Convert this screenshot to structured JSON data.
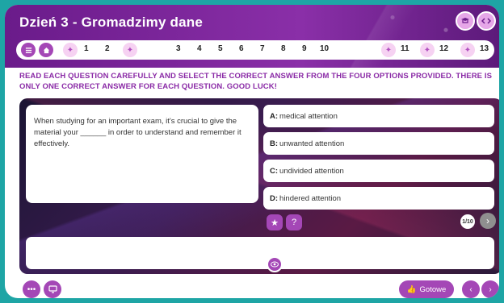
{
  "header": {
    "title": "Dzień 3 - Gromadzimy dane",
    "icons": {
      "left": "cap-icon",
      "right": "code-icon"
    }
  },
  "nav": {
    "menu_icon": "menu-icon",
    "home_icon": "home-icon",
    "numbers": [
      "1",
      "2",
      "3",
      "4",
      "5",
      "6",
      "7",
      "8",
      "9",
      "10",
      "11",
      "12",
      "13"
    ]
  },
  "instruction": "READ EACH QUESTION CAREFULLY AND SELECT THE CORRECT ANSWER FROM THE FOUR OPTIONS PROVIDED. THERE IS ONLY ONE CORRECT ANSWER FOR EACH QUESTION. GOOD LUCK!",
  "question": {
    "text": "When studying for an important exam, it's crucial to give the material your ______ in order to understand and remember it effectively."
  },
  "options": [
    {
      "key": "A:",
      "text": "medical attention"
    },
    {
      "key": "B:",
      "text": "unwanted attention"
    },
    {
      "key": "C:",
      "text": "undivided attention"
    },
    {
      "key": "D:",
      "text": "hindered attention"
    }
  ],
  "counter": "1/10",
  "footer": {
    "done_label": "Gotowe"
  },
  "colors": {
    "accent": "#a447b6",
    "header": "#6a1b8a",
    "instruction": "#8a2aa6",
    "background": "#1ea5a5"
  }
}
